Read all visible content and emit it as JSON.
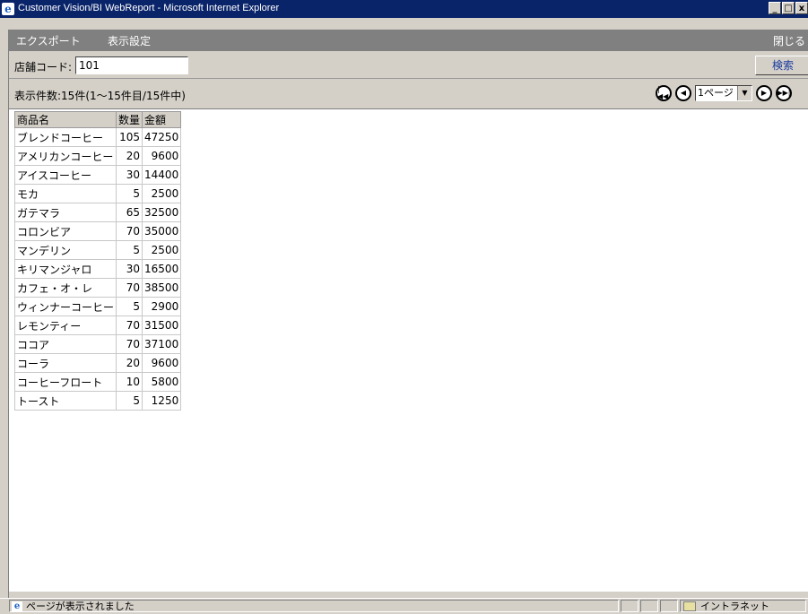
{
  "window": {
    "title": "Customer Vision/BI WebReport - Microsoft Internet Explorer",
    "minimize_glyph": "_",
    "maximize_glyph": "□",
    "close_glyph": "x"
  },
  "menu": {
    "export": "エクスポート",
    "display_settings": "表示設定",
    "close": "閉じる"
  },
  "search": {
    "label": "店舗コード:",
    "value": "101",
    "button": "検索"
  },
  "pager": {
    "summary": "表示件数:15件(1～15件目/15件中)",
    "page_select": "1ページ",
    "first_glyph": "|◀◀",
    "prev_glyph": "◀",
    "next_glyph": "▶",
    "last_glyph": "▶▶|"
  },
  "table": {
    "columns": [
      "商品名",
      "数量",
      "金額"
    ],
    "rows": [
      [
        "ブレンドコーヒー",
        "105",
        "47250"
      ],
      [
        "アメリカンコーヒー",
        "20",
        "9600"
      ],
      [
        "アイスコーヒー",
        "30",
        "14400"
      ],
      [
        "モカ",
        "5",
        "2500"
      ],
      [
        "ガテマラ",
        "65",
        "32500"
      ],
      [
        "コロンビア",
        "70",
        "35000"
      ],
      [
        "マンデリン",
        "5",
        "2500"
      ],
      [
        "キリマンジャロ",
        "30",
        "16500"
      ],
      [
        "カフェ・オ・レ",
        "70",
        "38500"
      ],
      [
        "ウィンナーコーヒー",
        "5",
        "2900"
      ],
      [
        "レモンティー",
        "70",
        "31500"
      ],
      [
        "ココア",
        "70",
        "37100"
      ],
      [
        "コーラ",
        "20",
        "9600"
      ],
      [
        "コーヒーフロート",
        "10",
        "5800"
      ],
      [
        "トースト",
        "5",
        "1250"
      ]
    ]
  },
  "status": {
    "message": "ページが表示されました",
    "zone": "イントラネット"
  },
  "icons": {
    "ie": "ie-logo-icon",
    "zone": "intranet-zone-icon"
  }
}
